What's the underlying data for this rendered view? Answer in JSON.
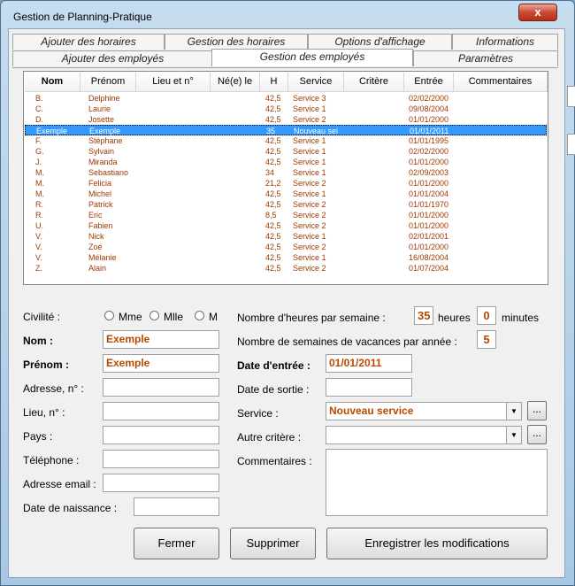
{
  "window": {
    "title": "Gestion de Planning-Pratique",
    "close_label": "x"
  },
  "tabs_row1": [
    "Ajouter des horaires",
    "Gestion des horaires",
    "Options d'affichage",
    "Informations"
  ],
  "tabs_row2": [
    "Ajouter des employés",
    "Gestion des employés",
    "Paramètres"
  ],
  "list": {
    "columns": [
      "Nom",
      "Prénom",
      "Lieu et n°",
      "Né(e) le",
      "H",
      "Service",
      "Critère",
      "Entrée",
      "Commentaires"
    ],
    "rows": [
      [
        "B.",
        "Delphine",
        "",
        "",
        "42,5",
        "Service 3",
        "",
        "02/02/2000",
        ""
      ],
      [
        "C.",
        "Laurie",
        "",
        "",
        "42,5",
        "Service 1",
        "",
        "09/08/2004",
        ""
      ],
      [
        "D.",
        "Josette",
        "",
        "",
        "42,5",
        "Service 2",
        "",
        "01/01/2000",
        ""
      ],
      [
        "Exemple",
        "Exemple",
        "",
        "",
        "35",
        "Nouveau sei",
        "",
        "01/01/2011",
        ""
      ],
      [
        "F.",
        "Stéphane",
        "",
        "",
        "42,5",
        "Service 1",
        "",
        "01/01/1995",
        ""
      ],
      [
        "G.",
        "Sylvain",
        "",
        "",
        "42,5",
        "Service 1",
        "",
        "02/02/2000",
        ""
      ],
      [
        "J.",
        "Miranda",
        "",
        "",
        "42,5",
        "Service 1",
        "",
        "01/01/2000",
        ""
      ],
      [
        "M.",
        "Sebastiano",
        "",
        "",
        "34",
        "Service 1",
        "",
        "02/09/2003",
        ""
      ],
      [
        "M.",
        "Felicia",
        "",
        "",
        "21,2",
        "Service 2",
        "",
        "01/01/2000",
        ""
      ],
      [
        "M.",
        "Michel",
        "",
        "",
        "42,5",
        "Service 1",
        "",
        "01/01/2004",
        ""
      ],
      [
        "R.",
        "Patrick",
        "",
        "",
        "42,5",
        "Service 2",
        "",
        "01/01/1970",
        ""
      ],
      [
        "R.",
        "Eric",
        "",
        "",
        "8,5",
        "Service 2",
        "",
        "01/01/2000",
        ""
      ],
      [
        "U.",
        "Fabien",
        "",
        "",
        "42,5",
        "Service 2",
        "",
        "01/01/2000",
        ""
      ],
      [
        "V.",
        "Nick",
        "",
        "",
        "42,5",
        "Service 1",
        "",
        "02/01/2001",
        ""
      ],
      [
        "V.",
        "Zoé",
        "",
        "",
        "42,5",
        "Service 2",
        "",
        "01/01/2000",
        ""
      ],
      [
        "V.",
        "Mélanie",
        "",
        "",
        "42,5",
        "Service 1",
        "",
        "16/08/2004",
        ""
      ],
      [
        "Z.",
        "Alain",
        "",
        "",
        "42,5",
        "Service 2",
        "",
        "01/07/2004",
        ""
      ]
    ],
    "selected_index": 3
  },
  "form": {
    "civilite_label": "Civilité :",
    "civ_options": [
      "Mme",
      "Mlle",
      "M"
    ],
    "nom_label": "Nom :",
    "nom_value": "Exemple",
    "prenom_label": "Prénom :",
    "prenom_value": "Exemple",
    "adresse_label": "Adresse, n° :",
    "adresse_value": "",
    "lieu_label": "Lieu, n° :",
    "lieu_value": "",
    "pays_label": "Pays :",
    "pays_value": "",
    "tel_label": "Téléphone :",
    "tel_value": "",
    "email_label": "Adresse email :",
    "email_value": "",
    "naissance_label": "Date de naissance :",
    "naissance_value": "",
    "heures_label": "Nombre d'heures par semaine :",
    "heures_value": "35",
    "heures_unit": "heures",
    "minutes_value": "0",
    "minutes_unit": "minutes",
    "vacances_label": "Nombre de semaines de vacances par année :",
    "vacances_value": "5",
    "entree_label": "Date d'entrée :",
    "entree_value": "01/01/2011",
    "sortie_label": "Date de sortie :",
    "sortie_value": "",
    "service_label": "Service :",
    "service_value": "Nouveau service",
    "critere_label": "Autre critère :",
    "critere_value": "",
    "comment_label": "Commentaires :",
    "ellipsis": "..."
  },
  "buttons": {
    "fermer": "Fermer",
    "supprimer": "Supprimer",
    "enregistrer": "Enregistrer les modifications"
  },
  "colors": {
    "value_text": "#b84a00",
    "selection": "#3399ff"
  }
}
